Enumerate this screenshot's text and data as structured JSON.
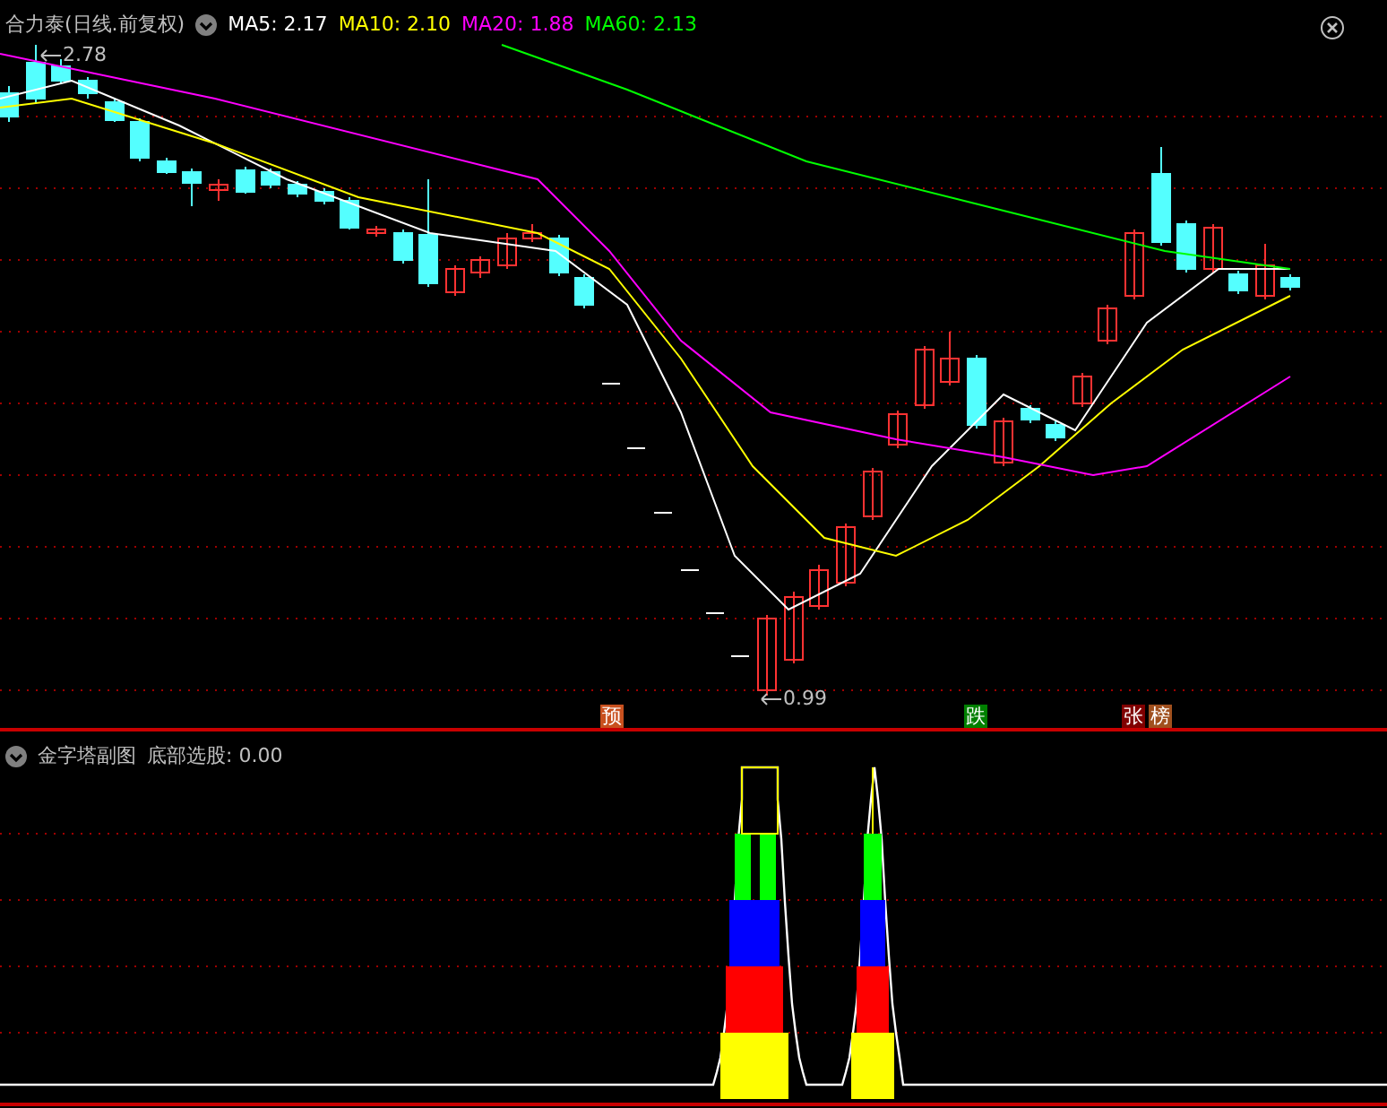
{
  "header": {
    "title": "合力泰(日线.前复权)",
    "indicators": [
      {
        "label": "MA5: 2.17",
        "color": "#ffffff"
      },
      {
        "label": "MA10: 2.10",
        "color": "#ffff00"
      },
      {
        "label": "MA20: 1.88",
        "color": "#ff00ff"
      },
      {
        "label": "MA60: 2.13",
        "color": "#00ff00"
      }
    ]
  },
  "main_chart": {
    "high_label": "2.78",
    "low_label": "0.99",
    "signals": [
      {
        "text": "预",
        "color": "#c8501e"
      },
      {
        "text": "跌",
        "color": "#008000"
      },
      {
        "text": "张",
        "color": "#800000"
      },
      {
        "text": "榜",
        "color": "#a0501e"
      }
    ]
  },
  "sub_chart": {
    "title": "金字塔副图",
    "reading": "底部选股: 0.00"
  }
}
